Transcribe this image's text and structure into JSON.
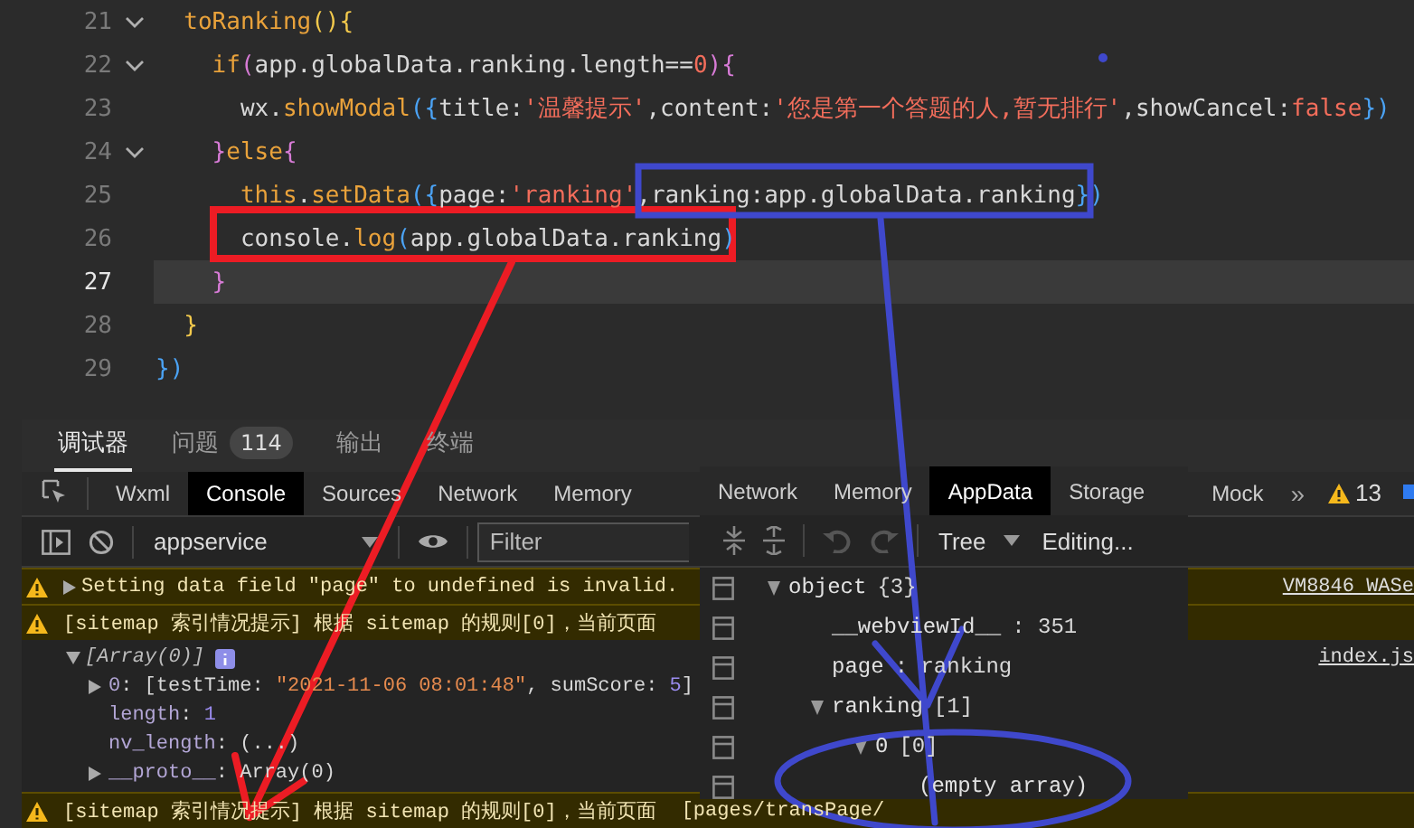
{
  "editor": {
    "lines": [
      {
        "number": "21",
        "foldable": true,
        "current": false,
        "tokens": [
          {
            "text": "  toRanking",
            "kind": "keyword"
          },
          {
            "text": "(){",
            "kind": "bracket1"
          }
        ]
      },
      {
        "number": "22",
        "foldable": true,
        "current": false,
        "tokens": [
          {
            "text": "    if",
            "kind": "keyword"
          },
          {
            "text": "(",
            "kind": "bracket2"
          },
          {
            "text": "app.globalData.ranking.length==",
            "kind": "plain"
          },
          {
            "text": "0",
            "kind": "string"
          },
          {
            "text": "){",
            "kind": "bracket2"
          }
        ]
      },
      {
        "number": "23",
        "foldable": false,
        "current": false,
        "tokens": [
          {
            "text": "      wx.",
            "kind": "plain"
          },
          {
            "text": "showModal",
            "kind": "keyword"
          },
          {
            "text": "({",
            "kind": "bracket3"
          },
          {
            "text": "title:",
            "kind": "plain"
          },
          {
            "text": "'温馨提示'",
            "kind": "string"
          },
          {
            "text": ",content:",
            "kind": "plain"
          },
          {
            "text": "'您是第一个答题的人,暂无排行'",
            "kind": "string"
          },
          {
            "text": ",showCancel:",
            "kind": "plain"
          },
          {
            "text": "false",
            "kind": "string"
          },
          {
            "text": "})",
            "kind": "bracket3"
          }
        ]
      },
      {
        "number": "24",
        "foldable": true,
        "current": false,
        "tokens": [
          {
            "text": "    }",
            "kind": "bracket2"
          },
          {
            "text": "else",
            "kind": "keyword"
          },
          {
            "text": "{",
            "kind": "bracket2"
          }
        ]
      },
      {
        "number": "25",
        "foldable": false,
        "current": false,
        "tokens": [
          {
            "text": "      this",
            "kind": "keyword"
          },
          {
            "text": ".",
            "kind": "plain"
          },
          {
            "text": "setData",
            "kind": "keyword"
          },
          {
            "text": "({",
            "kind": "bracket3"
          },
          {
            "text": "page:",
            "kind": "plain"
          },
          {
            "text": "'ranking'",
            "kind": "string"
          },
          {
            "text": ",ranking:app.globalData.ranking",
            "kind": "plain"
          },
          {
            "text": "})",
            "kind": "bracket3"
          }
        ]
      },
      {
        "number": "26",
        "foldable": false,
        "current": false,
        "tokens": [
          {
            "text": "      console.",
            "kind": "plain"
          },
          {
            "text": "log",
            "kind": "keyword"
          },
          {
            "text": "(",
            "kind": "bracket3"
          },
          {
            "text": "app.globalData.ranking",
            "kind": "plain"
          },
          {
            "text": ")",
            "kind": "bracket3"
          }
        ]
      },
      {
        "number": "27",
        "foldable": false,
        "current": true,
        "tokens": [
          {
            "text": "    }",
            "kind": "bracket2"
          }
        ]
      },
      {
        "number": "28",
        "foldable": false,
        "current": false,
        "tokens": [
          {
            "text": "  }",
            "kind": "bracket1"
          }
        ]
      },
      {
        "number": "29",
        "foldable": false,
        "current": false,
        "tokens": [
          {
            "text": "})",
            "kind": "bracket3"
          }
        ]
      }
    ]
  },
  "bottom_panel": {
    "tabs": [
      {
        "label": "调试器",
        "selected": true
      },
      {
        "label": "问题",
        "selected": false,
        "badge": "114"
      },
      {
        "label": "输出",
        "selected": false
      },
      {
        "label": "终端",
        "selected": false
      }
    ]
  },
  "devtools": {
    "tabs": [
      {
        "label": "Wxml",
        "selected": false
      },
      {
        "label": "Console",
        "selected": true
      },
      {
        "label": "Sources",
        "selected": false
      },
      {
        "label": "Network",
        "selected": false
      },
      {
        "label": "Memory",
        "selected": false
      }
    ],
    "right_tabs": [
      {
        "label": "Mock",
        "selected": false
      }
    ],
    "more": "»",
    "warning_count": "13",
    "toolbar": {
      "context": "appservice",
      "filter_placeholder": "Filter"
    },
    "messages": [
      {
        "kind": "warning",
        "expandable": true,
        "expanded": false,
        "text": "Setting data field \"page\" to undefined is invalid.",
        "source": "VM8846 WASe"
      },
      {
        "kind": "warning",
        "expandable": false,
        "text": "[sitemap 索引情况提示] 根据 sitemap 的规则[0]，当前页面"
      },
      {
        "kind": "log",
        "expandable": true,
        "expanded": true,
        "text": "[Array(0)]",
        "source": "index.js",
        "children": [
          {
            "key": "0",
            "expandable": true,
            "tokens": [
              {
                "text": ": [testTime: ",
                "kind": "plain"
              },
              {
                "text": "\"2021-11-06 08:01:48\"",
                "kind": "string"
              },
              {
                "text": ", sumScore: ",
                "kind": "plain"
              },
              {
                "text": "5",
                "kind": "number"
              },
              {
                "text": "]",
                "kind": "plain"
              }
            ]
          },
          {
            "key": "length",
            "expandable": false,
            "tokens": [
              {
                "text": ": ",
                "kind": "plain"
              },
              {
                "text": "1",
                "kind": "number"
              }
            ]
          },
          {
            "key": "nv_length",
            "expandable": false,
            "tokens": [
              {
                "text": ": (...)",
                "kind": "plain"
              }
            ]
          },
          {
            "key": "__proto__",
            "expandable": true,
            "tokens": [
              {
                "text": ": Array(0)",
                "kind": "plain"
              }
            ]
          }
        ]
      },
      {
        "kind": "warning",
        "expandable": false,
        "text": "[sitemap 索引情况提示] 根据 sitemap 的规则[0]，当前页面",
        "tail": "[pages/transPage/"
      }
    ]
  },
  "appdata_panel": {
    "tabs": [
      {
        "label": "Network",
        "selected": false
      },
      {
        "label": "Memory",
        "selected": false
      },
      {
        "label": "AppData",
        "selected": true
      },
      {
        "label": "Storage",
        "selected": false
      }
    ],
    "view": "Tree",
    "mode": "Editing...",
    "tree": [
      {
        "key": "object",
        "value": "{3}",
        "expanded": true,
        "children": [
          {
            "key": "__webviewId__",
            "value": ": 351"
          },
          {
            "key": "page",
            "value": ": ranking"
          },
          {
            "key": "ranking",
            "value": "[1]",
            "expanded": true,
            "children": [
              {
                "key": "0",
                "value": "[0]",
                "expanded": true,
                "children": [
                  {
                    "key": "(empty array)"
                  }
                ]
              }
            ]
          }
        ]
      }
    ]
  }
}
